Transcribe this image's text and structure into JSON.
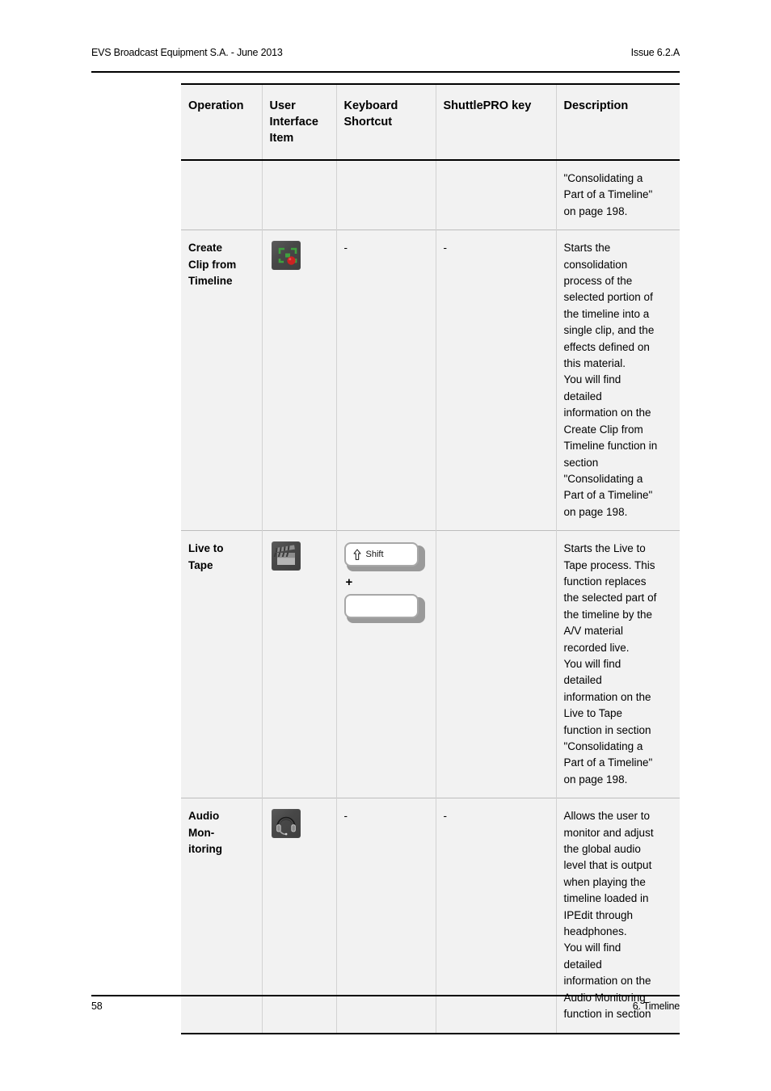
{
  "header": {
    "left": "EVS Broadcast Equipment S.A.  - June 2013",
    "right": "Issue 6.2.A"
  },
  "footer": {
    "page_number": "58",
    "chapter": "6. Timeline"
  },
  "table": {
    "columns": [
      {
        "id": "operation",
        "label": "Operation"
      },
      {
        "id": "ui_item",
        "label": "User Interface Item"
      },
      {
        "id": "keyboard_shortcut",
        "label": "Keyboard Shortcut"
      },
      {
        "id": "shuttlepro_key",
        "label": "ShuttlePRO key"
      },
      {
        "id": "description",
        "label": "Description"
      }
    ],
    "rows": [
      {
        "operation": "",
        "ui_item_icon": "",
        "keyboard_shortcut": "",
        "shuttlepro_key": "",
        "description_lines": [
          "\"Consolidating a",
          "Part of a Timeline\"",
          "on page 198."
        ]
      },
      {
        "operation_lines": [
          "Create",
          "Clip from",
          "Timeline"
        ],
        "ui_item_icon": "create-clip-from-timeline-icon",
        "keyboard_shortcut": "-",
        "shuttlepro_key": "-",
        "description_lines": [
          "Starts the",
          "consolidation",
          "process of the",
          "selected portion of",
          "the timeline into a",
          "single clip, and the",
          "effects defined on",
          "this material.",
          "You will find",
          "detailed",
          "information on the",
          "Create Clip from",
          "Timeline function in",
          "section",
          "\"Consolidating a",
          "Part of a Timeline\"",
          "on page 198."
        ]
      },
      {
        "operation_lines": [
          "Live to",
          "Tape"
        ],
        "ui_item_icon": "live-to-tape-clapperboard-icon",
        "keyboard_shortcut_keys": [
          "Shift",
          ""
        ],
        "keyboard_shortcut_separator": "+",
        "shuttlepro_key": "",
        "description_lines": [
          "Starts the Live to",
          "Tape process. This",
          "function replaces",
          "the selected part of",
          "the timeline by the",
          "A/V material",
          "recorded live.",
          "You will find",
          "detailed",
          "information on the",
          "Live to Tape",
          "function in section",
          "\"Consolidating a",
          "Part of a Timeline\"",
          "on page 198."
        ]
      },
      {
        "operation_lines": [
          "Audio",
          "Mon-",
          "itoring"
        ],
        "ui_item_icon": "audio-monitoring-headset-icon",
        "keyboard_shortcut": "-",
        "shuttlepro_key": "-",
        "description_lines": [
          "Allows the user to",
          "monitor and adjust",
          "the global audio",
          "level that is output",
          "when playing the",
          "timeline loaded in",
          "IPEdit through",
          "headphones.",
          "You will find",
          "detailed",
          "information on the",
          "Audio Monitoring",
          "function in section"
        ]
      }
    ]
  },
  "colors": {
    "table_cell_background": "#f2f2f2",
    "table_border_strong": "#000000",
    "table_border_light": "#bdbdbd",
    "icon_background": "#4a4a4a",
    "icon_green": "#3fa03f",
    "icon_red": "#cc2222",
    "key_shadow": "#9a9a9a"
  }
}
